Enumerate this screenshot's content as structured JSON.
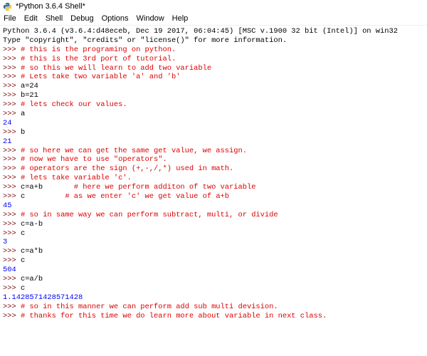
{
  "window": {
    "title": "*Python 3.6.4 Shell*"
  },
  "menu": [
    {
      "label": "File"
    },
    {
      "label": "Edit"
    },
    {
      "label": "Shell"
    },
    {
      "label": "Debug"
    },
    {
      "label": "Options"
    },
    {
      "label": "Window"
    },
    {
      "label": "Help"
    }
  ],
  "colors": {
    "prompt": "#770000",
    "comment": "#dd0000",
    "output": "#0000ff",
    "code": "#000000"
  },
  "shell": {
    "lines": [
      {
        "type": "banner",
        "text": "Python 3.6.4 (v3.6.4:d48eceb, Dec 19 2017, 06:04:45) [MSC v.1900 32 bit (Intel)] on win32"
      },
      {
        "type": "banner",
        "text": "Type \"copyright\", \"credits\" or \"license()\" for more information."
      },
      {
        "type": "input",
        "prompt": ">>> ",
        "code": "",
        "comment": "# this is the programing on python."
      },
      {
        "type": "input",
        "prompt": ">>> ",
        "code": "",
        "comment": "# this is the 3rd port of tutorial."
      },
      {
        "type": "input",
        "prompt": ">>> ",
        "code": "",
        "comment": "# so this we will learn to add two variable"
      },
      {
        "type": "input",
        "prompt": ">>> ",
        "code": "",
        "comment": "# Lets take two variable 'a' and 'b'"
      },
      {
        "type": "input",
        "prompt": ">>> ",
        "code": "a=24",
        "comment": ""
      },
      {
        "type": "input",
        "prompt": ">>> ",
        "code": "b=21",
        "comment": ""
      },
      {
        "type": "input",
        "prompt": ">>> ",
        "code": "",
        "comment": "# lets check our values."
      },
      {
        "type": "input",
        "prompt": ">>> ",
        "code": "a",
        "comment": ""
      },
      {
        "type": "output",
        "text": "24"
      },
      {
        "type": "input",
        "prompt": ">>> ",
        "code": "b",
        "comment": ""
      },
      {
        "type": "output",
        "text": "21"
      },
      {
        "type": "input",
        "prompt": ">>> ",
        "code": "",
        "comment": "# so here we can get the same get value, we assign."
      },
      {
        "type": "input",
        "prompt": ">>> ",
        "code": "",
        "comment": "# now we have to use \"operators\"."
      },
      {
        "type": "input",
        "prompt": ">>> ",
        "code": "",
        "comment": "# operators are the sign (+,-,/,*) used in math."
      },
      {
        "type": "input",
        "prompt": ">>> ",
        "code": "",
        "comment": "# lets take variable 'c'."
      },
      {
        "type": "input",
        "prompt": ">>> ",
        "code": "c=a+b       ",
        "comment": "# here we perform additon of two variable"
      },
      {
        "type": "input",
        "prompt": ">>> ",
        "code": "c         ",
        "comment": "# as we enter 'c' we get value of a+b"
      },
      {
        "type": "output",
        "text": "45"
      },
      {
        "type": "input",
        "prompt": ">>> ",
        "code": "",
        "comment": "# so in same way we can perform subtract, multi, or divide"
      },
      {
        "type": "input",
        "prompt": ">>> ",
        "code": "c=a-b",
        "comment": ""
      },
      {
        "type": "input",
        "prompt": ">>> ",
        "code": "c",
        "comment": ""
      },
      {
        "type": "output",
        "text": "3"
      },
      {
        "type": "input",
        "prompt": ">>> ",
        "code": "c=a*b",
        "comment": ""
      },
      {
        "type": "input",
        "prompt": ">>> ",
        "code": "c",
        "comment": ""
      },
      {
        "type": "output",
        "text": "504"
      },
      {
        "type": "input",
        "prompt": ">>> ",
        "code": "c=a/b",
        "comment": ""
      },
      {
        "type": "input",
        "prompt": ">>> ",
        "code": "c",
        "comment": ""
      },
      {
        "type": "output",
        "text": "1.1428571428571428"
      },
      {
        "type": "input",
        "prompt": ">>> ",
        "code": "",
        "comment": "# so in this manner we can perform add sub multi devision."
      },
      {
        "type": "input",
        "prompt": ">>> ",
        "code": "",
        "comment": "# thanks for this time we do learn more about variable in next class."
      }
    ]
  }
}
